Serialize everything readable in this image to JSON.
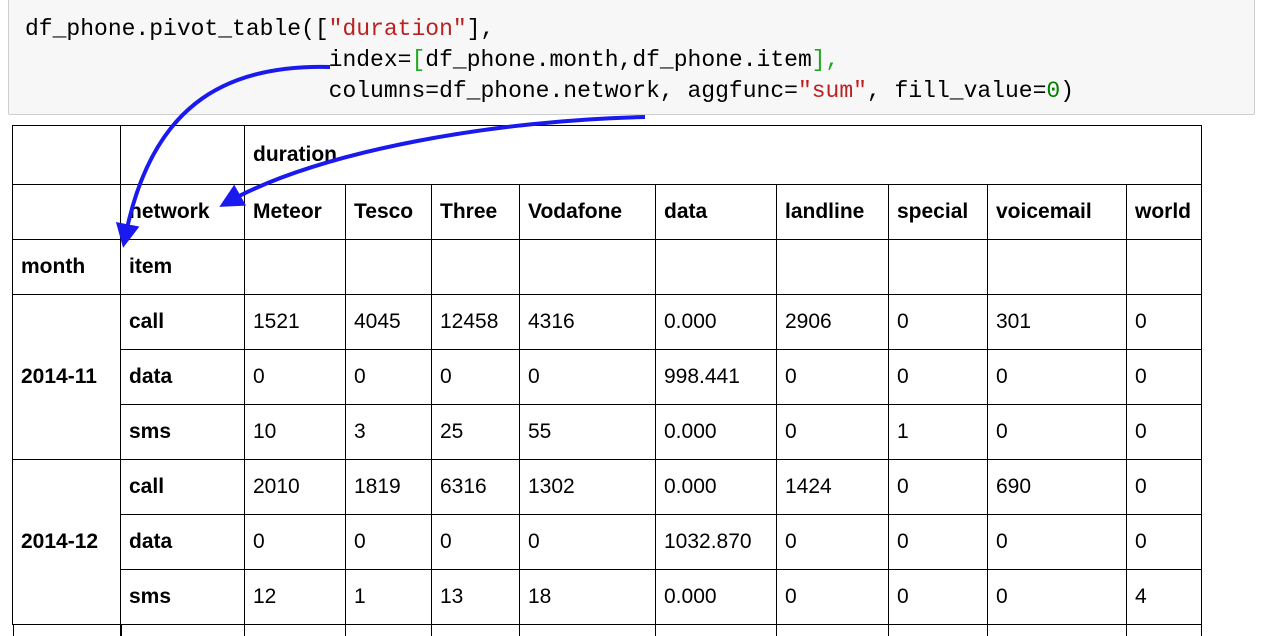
{
  "code": {
    "line1": {
      "a": "df_phone.pivot_table(",
      "b": "[",
      "c": "\"duration\"",
      "d": "],"
    },
    "line2": {
      "indent": "                      index=",
      "b": "[",
      "c": "df_phone.month,df_phone.item",
      "d": "],"
    },
    "line3": {
      "indent": "                      columns=df_phone.network, aggfunc=",
      "c": "\"sum\"",
      "e": ", fill_value=",
      "n": "0",
      "f": ")"
    }
  },
  "table": {
    "top_header": "duration",
    "network_label": "network",
    "columns": [
      "Meteor",
      "Tesco",
      "Three",
      "Vodafone",
      "data",
      "landline",
      "special",
      "voicemail",
      "world"
    ],
    "index_names": [
      "month",
      "item"
    ],
    "groups": [
      {
        "month": "2014-11",
        "rows": [
          {
            "item": "call",
            "values": [
              "1521",
              "4045",
              "12458",
              "4316",
              "0.000",
              "2906",
              "0",
              "301",
              "0"
            ]
          },
          {
            "item": "data",
            "values": [
              "0",
              "0",
              "0",
              "0",
              "998.441",
              "0",
              "0",
              "0",
              "0"
            ]
          },
          {
            "item": "sms",
            "values": [
              "10",
              "3",
              "25",
              "55",
              "0.000",
              "0",
              "1",
              "0",
              "0"
            ]
          }
        ]
      },
      {
        "month": "2014-12",
        "rows": [
          {
            "item": "call",
            "values": [
              "2010",
              "1819",
              "6316",
              "1302",
              "0.000",
              "1424",
              "0",
              "690",
              "0"
            ]
          },
          {
            "item": "data",
            "values": [
              "0",
              "0",
              "0",
              "0",
              "1032.870",
              "0",
              "0",
              "0",
              "0"
            ]
          },
          {
            "item": "sms",
            "values": [
              "12",
              "1",
              "13",
              "18",
              "0.000",
              "0",
              "0",
              "0",
              "4"
            ]
          }
        ]
      }
    ]
  },
  "colors": {
    "arrow": "#1a1aee",
    "string": "#ba2121",
    "bracket": "#22a822",
    "number": "#008000",
    "cell_bg": "#f7f7f7"
  }
}
